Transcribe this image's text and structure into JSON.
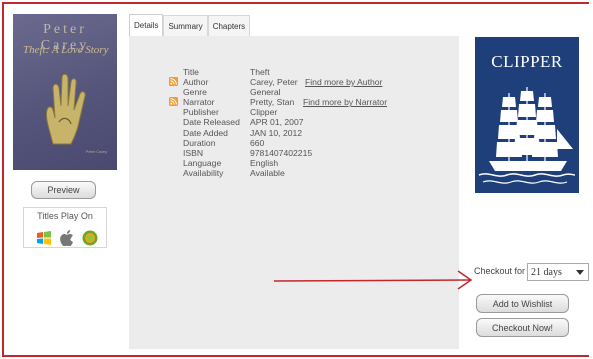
{
  "cover": {
    "author": "Peter Carey",
    "title": "Theft: A Love Story",
    "small_text": "Peter Carey"
  },
  "left": {
    "preview_label": "Preview",
    "plays_on_label": "Titles Play On",
    "platform_icons": [
      "windows-icon",
      "apple-icon",
      "android-icon"
    ]
  },
  "tabs": [
    {
      "label": "Details",
      "active": true
    },
    {
      "label": "Summary",
      "active": false
    },
    {
      "label": "Chapters",
      "active": false
    }
  ],
  "details": {
    "rows": [
      {
        "label": "Title",
        "value": "Theft",
        "rss": false,
        "more": ""
      },
      {
        "label": "Author",
        "value": "Carey, Peter",
        "rss": true,
        "more": "Find more by Author"
      },
      {
        "label": "Genre",
        "value": "General",
        "rss": false,
        "more": ""
      },
      {
        "label": "Narrator",
        "value": "Pretty, Stan",
        "rss": true,
        "more": "Find more by Narrator"
      },
      {
        "label": "Publisher",
        "value": "Clipper",
        "rss": false,
        "more": ""
      },
      {
        "label": "Date Released",
        "value": "APR 01, 2007",
        "rss": false,
        "more": ""
      },
      {
        "label": "Date Added",
        "value": "JAN 10, 2012",
        "rss": false,
        "more": ""
      },
      {
        "label": "Duration",
        "value": "660",
        "rss": false,
        "more": ""
      },
      {
        "label": "ISBN",
        "value": "9781407402215",
        "rss": false,
        "more": ""
      },
      {
        "label": "Language",
        "value": "English",
        "rss": false,
        "more": ""
      },
      {
        "label": "Availability",
        "value": "Available",
        "rss": false,
        "more": ""
      }
    ]
  },
  "publisher_logo": {
    "text": "CLIPPER"
  },
  "checkout": {
    "label": "Checkout for",
    "selected": "21 days",
    "wishlist_label": "Add to Wishlist",
    "checkout_label": "Checkout Now!"
  },
  "colors": {
    "frame": "#c2272d",
    "arrow": "#c2272d",
    "rss": "#f29a2e",
    "logo_bg": "#1e3f7a"
  }
}
